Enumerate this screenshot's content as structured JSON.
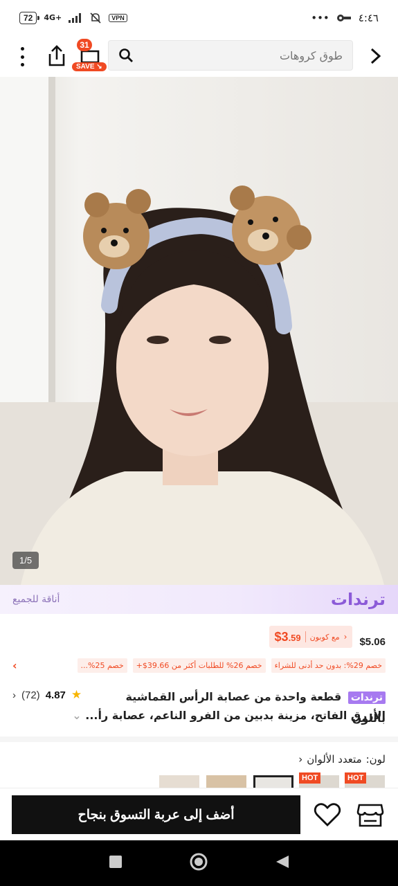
{
  "status_bar": {
    "time": "٤:٤٦",
    "battery": "72",
    "network": "4G+",
    "vpn": "VPN",
    "dots": "•••"
  },
  "top_nav": {
    "search_placeholder": "طوق كروهات",
    "cart_count": "31",
    "cart_save": "SAVE"
  },
  "hero": {
    "page_indicator": "1/5"
  },
  "trends": {
    "logo": "ترندات",
    "tag": "أناقة للجميع"
  },
  "price": {
    "original": "$5.06",
    "coupon_price_main": "$3",
    "coupon_price_cents": ".59",
    "coupon_label": "مع كوبون",
    "coupon_arrow": "›"
  },
  "discounts": [
    "خصم 29%: بدون حد أدنى للشراء",
    "خصم 26% للطلبات أكثر من 39.66$+",
    "خصم 25%..."
  ],
  "product": {
    "tag": "ترندات",
    "title_line1": "قطعة واحدة من عصابة الرأس القماشية باللون",
    "title_line2": "الأزرق الفاتح، مزينة بدبين من الفرو الناعم، عصابة رأ...",
    "rating": "4.87",
    "review_count": "(72)"
  },
  "color_section": {
    "label": "لون:",
    "value": "متعدد الألوان",
    "hot_label": "HOT"
  },
  "bottom_bar": {
    "add_to_cart": "أضف إلى عربة التسوق بنجاح"
  },
  "colors": {
    "accent": "#f04a23",
    "trends_purple": "#8c5bd8",
    "star": "#f7b500"
  }
}
